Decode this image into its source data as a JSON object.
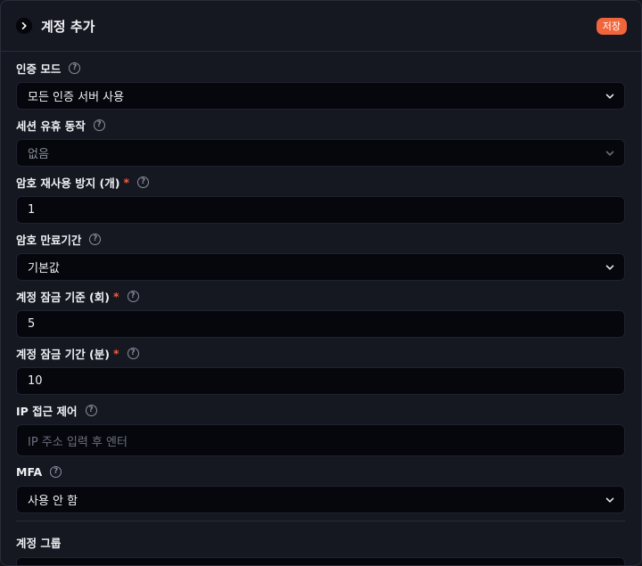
{
  "header": {
    "title": "계정 추가",
    "save_label": "저장"
  },
  "fields": {
    "auth_mode": {
      "label": "인증 모드",
      "value": "모든 인증 서버 사용"
    },
    "session_keep": {
      "label": "세션 유휴 동작",
      "value": "없음"
    },
    "pw_reuse": {
      "label": "암호 재사용 방지 (개)",
      "required": "*",
      "value": "1"
    },
    "pw_expire": {
      "label": "암호 만료기간",
      "value": "기본값"
    },
    "lock_threshold": {
      "label": "계정 잠금 기준 (회)",
      "required": "*",
      "value": "5"
    },
    "lock_duration": {
      "label": "계정 잠금 기간 (분)",
      "required": "*",
      "value": "10"
    },
    "ip_access": {
      "label": "IP 접근 제어",
      "placeholder": "IP 주소 입력 후 엔터"
    },
    "mfa": {
      "label": "MFA",
      "value": "사용 안 함"
    },
    "account_group": {
      "label": "계정 그룹"
    }
  },
  "icons": {
    "help": "?",
    "header_toggle": "chevron-right-icon",
    "select_caret": "chevron-down-icon"
  },
  "colors": {
    "accent": "#f0653a",
    "required": "#ff5a3c"
  }
}
